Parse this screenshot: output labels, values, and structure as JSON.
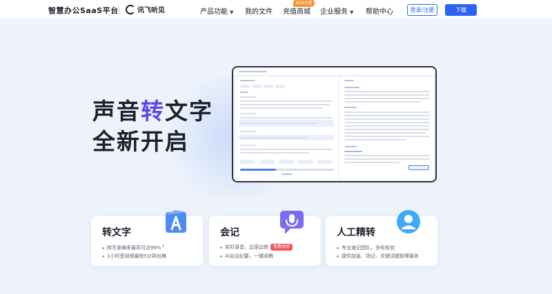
{
  "header": {
    "brand": "智慧办公SaaS平台",
    "logo_text": "讯飞听见",
    "nav": [
      {
        "label": "产品功能",
        "has_caret": true
      },
      {
        "label": "我的文件",
        "has_caret": false
      },
      {
        "label": "充值商城",
        "has_caret": false,
        "badge": "618大促"
      },
      {
        "label": "企业服务",
        "has_caret": true
      },
      {
        "label": "帮助中心",
        "has_caret": false
      }
    ],
    "login_label": "登录/注册",
    "download_label": "下载"
  },
  "hero": {
    "line1_part1": "声音",
    "line1_accent": "转",
    "line1_part2": "文字",
    "line2": "全新开启"
  },
  "cards": [
    {
      "title": "转文字",
      "bullets": [
        "转写准确率最高可达98%",
        "1小时音视频最快5分钟出稿"
      ],
      "sup": "1"
    },
    {
      "title": "会记",
      "bullets": [
        "实时录音，边录边转",
        "AI会议纪要，一键成稿"
      ],
      "tag": "免费体验"
    },
    {
      "title": "人工精转",
      "bullets": [
        "专业速记团队，多轮校验",
        "提供加急、场记、关键词提取等服务"
      ]
    }
  ],
  "colors": {
    "accent_purple": "#5f45e6",
    "primary_blue": "#2b62f2",
    "promo_orange": "#f29538",
    "free_tag_red": "#f2565a"
  },
  "icons": [
    "translate-icon",
    "microphone-icon",
    "person-icon",
    "chevron-down-icon"
  ]
}
